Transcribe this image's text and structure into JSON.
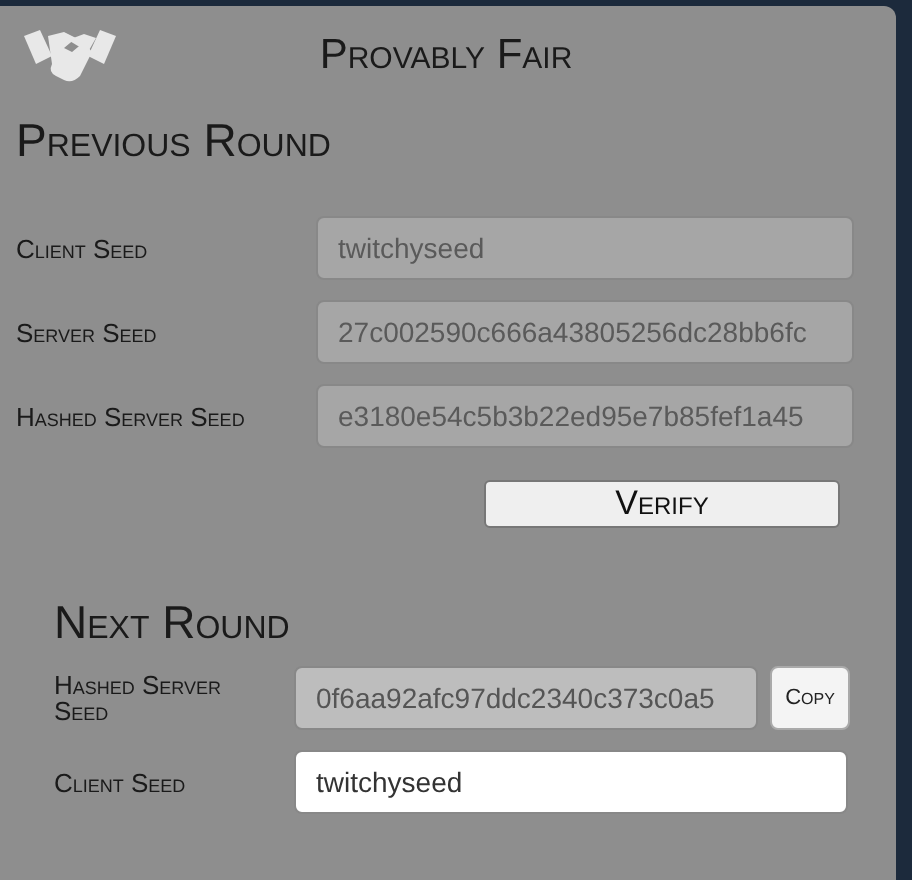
{
  "dialog": {
    "title": "Provably Fair"
  },
  "previous_round": {
    "heading": "Previous Round",
    "fields": [
      {
        "label": "Client Seed",
        "value": "twitchyseed",
        "editable": false
      },
      {
        "label": "Server Seed",
        "value": "27c002590c666a43805256dc28bb6fc",
        "editable": false
      },
      {
        "label": "Hashed Server Seed",
        "value": "e3180e54c5b3b22ed95e7b85fef1a45",
        "editable": false
      }
    ],
    "button": "Verify"
  },
  "next_round": {
    "heading": "Next Round",
    "fields": [
      {
        "label": "Hashed Server Seed",
        "value": "0f6aa92afc97ddc2340c373c0a5",
        "editable": false,
        "copy_button": "Copy"
      },
      {
        "label": "Client Seed",
        "value": "twitchyseed",
        "editable": true
      }
    ]
  }
}
